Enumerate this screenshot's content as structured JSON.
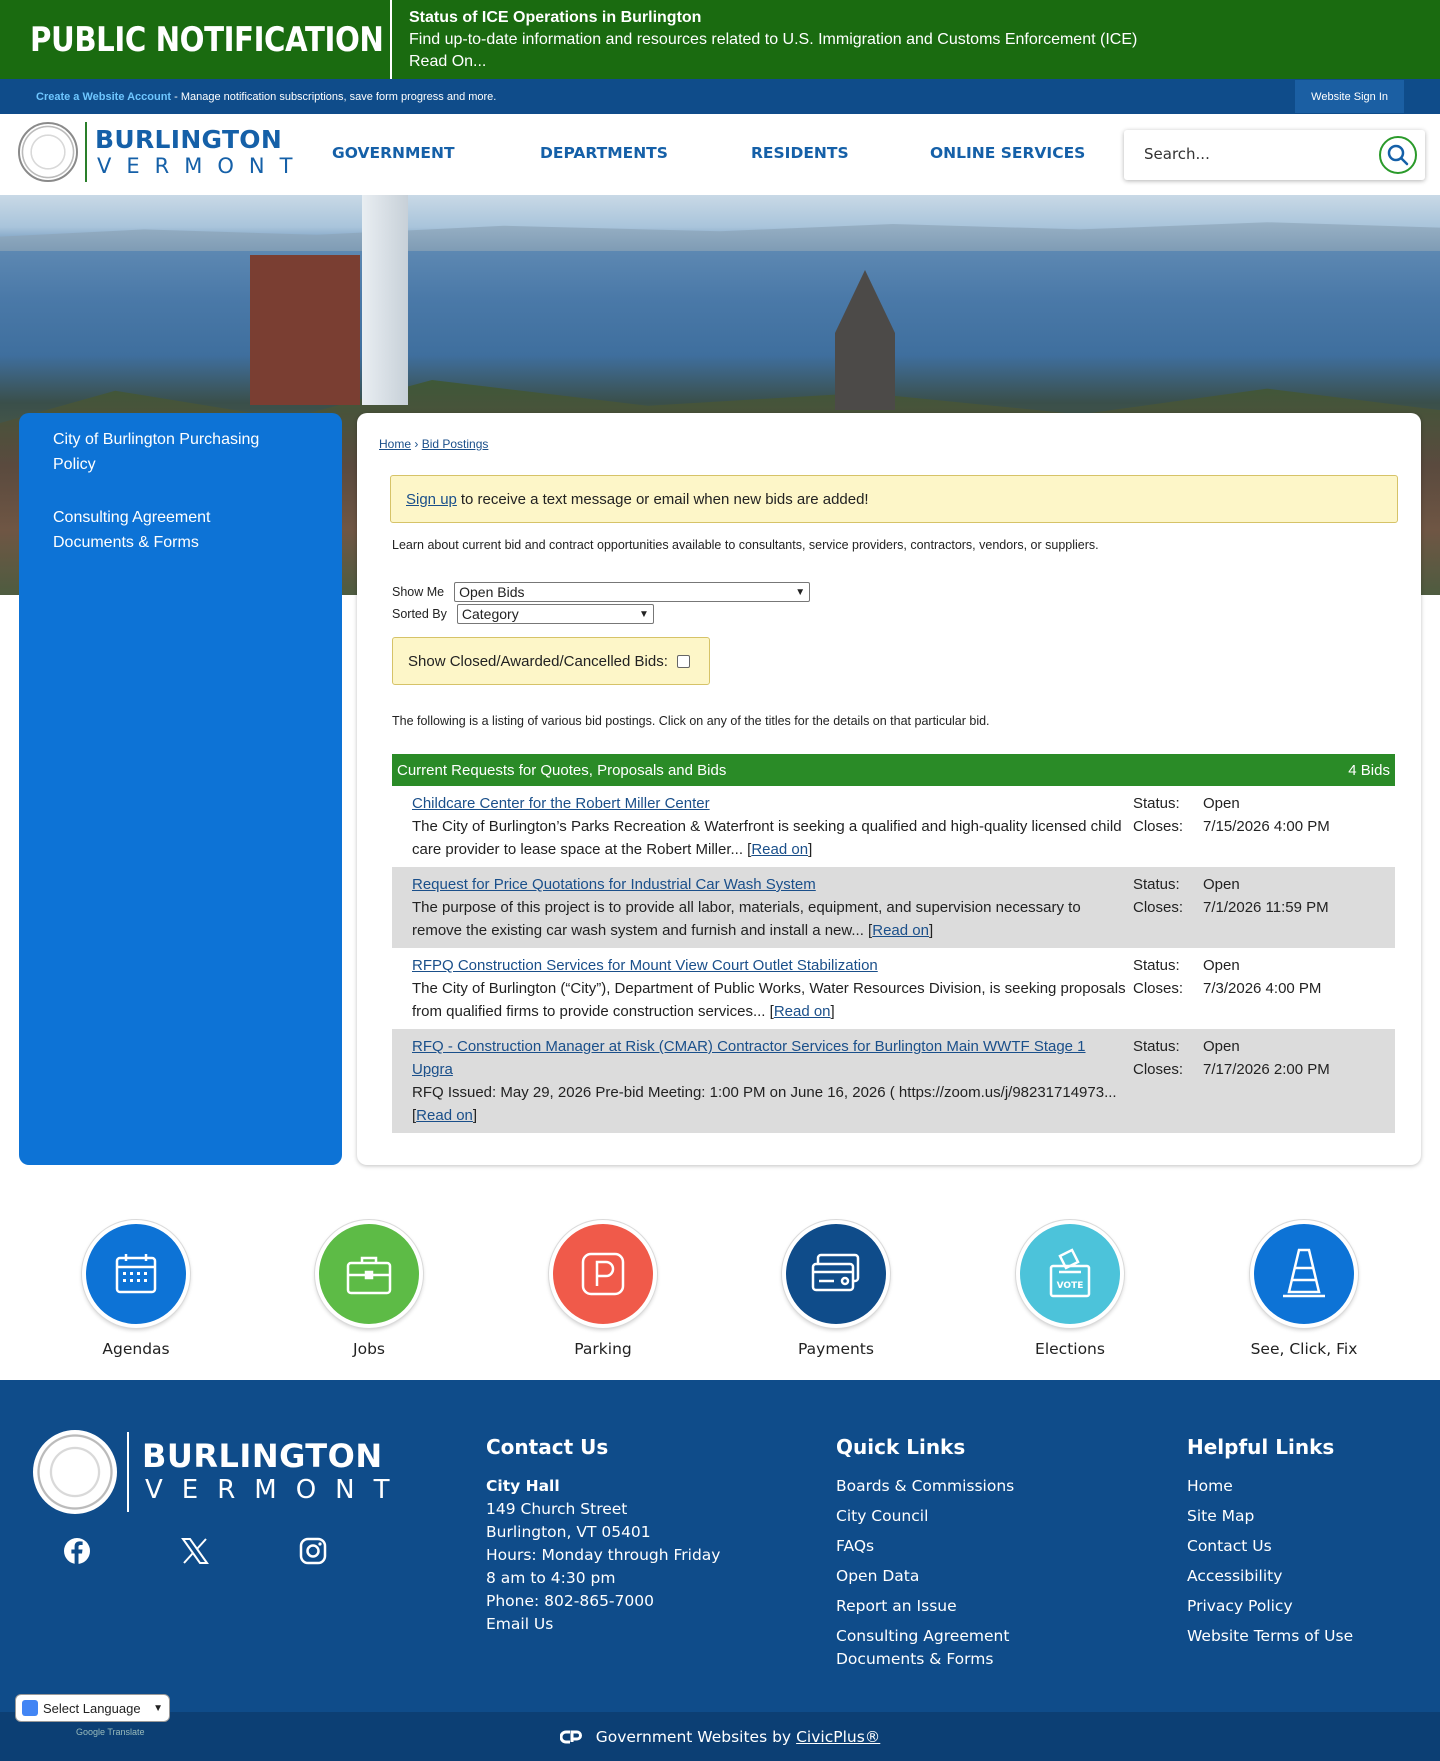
{
  "alert": {
    "brand": "PUBLIC NOTIFICATION",
    "title": "Status of ICE Operations in Burlington",
    "text": "Find up-to-date information and resources related to U.S. Immigration and Customs Enforcement (ICE)",
    "read_on": "Read On..."
  },
  "account": {
    "create": "Create a Website Account",
    "desc": " - Manage notification subscriptions, save form progress and more.",
    "signin": "Website Sign In"
  },
  "logo": {
    "name": "BURLINGTON",
    "state": "VERMONT"
  },
  "nav": {
    "government": "GOVERNMENT",
    "departments": "DEPARTMENTS",
    "residents": "RESIDENTS",
    "online_services": "ONLINE SERVICES"
  },
  "search": {
    "placeholder": "Search..."
  },
  "sidebar": {
    "items": [
      {
        "label": "City of Burlington Purchasing Policy"
      },
      {
        "label": "Consulting Agreement Documents & Forms"
      }
    ]
  },
  "breadcrumb": {
    "home": "Home",
    "sep": " › ",
    "current": "Bid Postings"
  },
  "signup": {
    "link": "Sign up",
    "text": "to receive a text message or email when new bids are added!"
  },
  "intro": "Learn about current bid and contract opportunities available to consultants, service providers, contractors, vendors, or suppliers.",
  "filters": {
    "show_me_label": "Show Me",
    "show_me_value": "Open Bids",
    "sorted_by_label": "Sorted By",
    "sorted_by_value": "Category",
    "closed_label": "Show Closed/Awarded/Cancelled Bids:"
  },
  "listing_note": "The following is a listing of various bid postings. Click on any of the titles for the details on that particular bid.",
  "bids": {
    "header": "Current Requests for Quotes, Proposals and Bids",
    "count": "4 Bids",
    "status_label": "Status:",
    "closes_label": "Closes:",
    "read_on": "Read on",
    "rows": [
      {
        "title": "Childcare Center for the Robert Miller Center",
        "desc": "The City of Burlington’s Parks Recreation & Waterfront is seeking a qualified and high-quality licensed child care provider to lease space at the Robert Miller...",
        "status": "Open",
        "closes": "7/15/2026 4:00 PM"
      },
      {
        "title": "Request for Price Quotations for Industrial Car Wash System",
        "desc": "The purpose of this project is to provide all labor, materials, equipment, and supervision necessary to remove the existing car wash system and furnish and install a new...",
        "status": "Open",
        "closes": "7/1/2026 11:59 PM"
      },
      {
        "title": "RFPQ Construction Services for Mount View Court Outlet Stabilization",
        "desc": "The City of Burlington (“City”), Department of Public Works, Water Resources Division, is seeking proposals from qualified firms to provide construction services...",
        "status": "Open",
        "closes": "7/3/2026 4:00 PM"
      },
      {
        "title": "RFQ - Construction Manager at Risk (CMAR) Contractor Services for Burlington Main WWTF Stage 1 Upgra",
        "desc": "RFQ Issued: May 29, 2026 Pre-bid Meeting: 1:00 PM on June 16, 2026 ( https://zoom.us/j/98231714973...",
        "status": "Open",
        "closes": "7/17/2026 2:00 PM"
      }
    ]
  },
  "quick": [
    {
      "label": "Agendas",
      "color": "#0d73d6",
      "icon": "calendar-icon"
    },
    {
      "label": "Jobs",
      "color": "#5dbb46",
      "icon": "briefcase-icon"
    },
    {
      "label": "Parking",
      "color": "#f05a4a",
      "icon": "parking-icon"
    },
    {
      "label": "Payments",
      "color": "#0f4c8a",
      "icon": "payment-card-icon"
    },
    {
      "label": "Elections",
      "color": "#4cc3da",
      "icon": "ballot-box-icon"
    },
    {
      "label": "See, Click, Fix",
      "color": "#0d73d6",
      "icon": "traffic-cone-icon"
    }
  ],
  "footer": {
    "contact": {
      "heading": "Contact Us",
      "place": "City Hall",
      "street": "149 Church Street",
      "city": "Burlington, VT 05401",
      "hours1": "Hours: Monday through Friday",
      "hours2": "8 am to 4:30 pm",
      "phone": "Phone: 802-865-7000",
      "email": "Email Us"
    },
    "quick_links": {
      "heading": "Quick Links",
      "items": [
        "Boards & Commissions",
        "City Council",
        "FAQs",
        "Open Data",
        "Report an Issue",
        "Consulting Agreement Documents & Forms"
      ]
    },
    "helpful_links": {
      "heading": "Helpful Links",
      "items": [
        "Home",
        "Site Map",
        "Contact Us",
        "Accessibility",
        "Privacy Policy",
        "Website Terms of Use"
      ]
    },
    "credit_text": "Government Websites by",
    "credit_link": "CivicPlus®",
    "translate": "Select Language",
    "powered": "Google Translate"
  },
  "colors": {
    "alert_green": "#1a6b10",
    "brand_blue": "#1560a8",
    "sidebar_blue": "#0d73d6",
    "footer_blue": "#0f4c8a",
    "table_green": "#2a8b27"
  }
}
